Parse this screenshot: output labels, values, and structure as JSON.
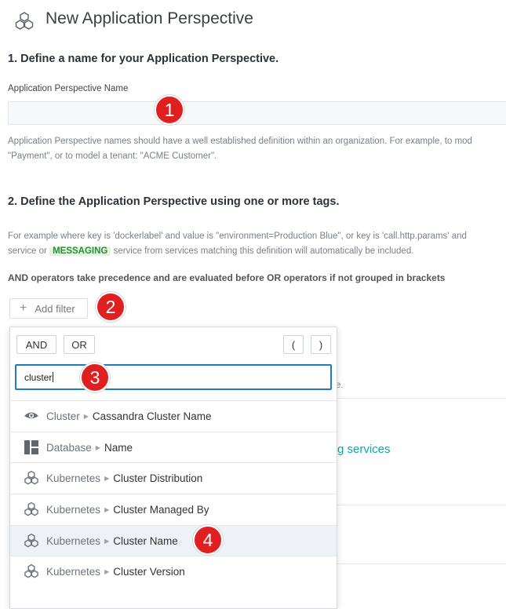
{
  "page": {
    "title": "New Application Perspective"
  },
  "step1": {
    "heading": "1. Define a name for your Application Perspective.",
    "field_label": "Application Perspective Name",
    "input_value": "",
    "help_line1": "Application Perspective names should have a well established definition within an organization. For example, to mod",
    "help_line2": "\"Payment\", or to model a tenant: \"ACME Customer\"."
  },
  "step2": {
    "heading": "2. Define the Application Perspective using one or more tags.",
    "help_line1": "For example where key is 'dockerlabel' and value is \"environment=Production Blue\", or key is 'call.http.params' and",
    "help_line2_pre": "service or",
    "help_line2_tag": "MESSAGING",
    "help_line2_post": "service from services matching this definition will automatically be included.",
    "operator_note": "AND operators take precedence and are evaluated before OR operators if not grouped in brackets",
    "add_filter_label": "Add filter"
  },
  "background": {
    "partial_link": "g services",
    "partial_fragment": "e."
  },
  "dropdown": {
    "and_label": "AND",
    "or_label": "OR",
    "open_paren": "(",
    "close_paren": ")",
    "search_value": "cluster",
    "options": [
      {
        "category": "Cluster",
        "item": "Cassandra Cluster Name",
        "icon": "eye-icon"
      },
      {
        "category": "Database",
        "item": "Name",
        "icon": "database-icon"
      },
      {
        "category": "Kubernetes",
        "item": "Cluster Distribution",
        "icon": "kubernetes-icon"
      },
      {
        "category": "Kubernetes",
        "item": "Cluster Managed By",
        "icon": "kubernetes-icon"
      },
      {
        "category": "Kubernetes",
        "item": "Cluster Name",
        "icon": "kubernetes-icon"
      },
      {
        "category": "Kubernetes",
        "item": "Cluster Version",
        "icon": "kubernetes-icon"
      }
    ]
  },
  "annotations": {
    "m1": "1",
    "m2": "2",
    "m3": "3",
    "m4": "4"
  },
  "colors": {
    "accent": "#1a7fc1",
    "marker": "#e02020",
    "link": "#12a5a5",
    "messaging": "#2c8c3a"
  }
}
